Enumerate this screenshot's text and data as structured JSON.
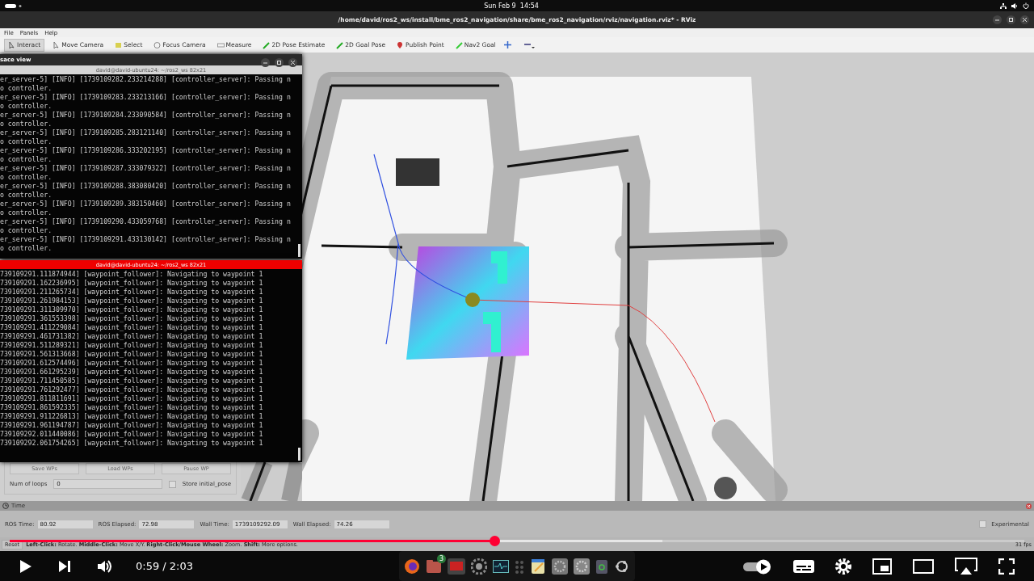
{
  "top_bar": {
    "clock": "Sun Feb 9  14:54"
  },
  "rviz": {
    "title": "/home/david/ros2_ws/install/bme_ros2_navigation/share/bme_ros2_navigation/rviz/navigation.rviz* - RViz",
    "menu": [
      "File",
      "Panels",
      "Help"
    ],
    "tools": [
      {
        "label": "Interact",
        "selected": true
      },
      {
        "label": "Move Camera",
        "selected": false
      },
      {
        "label": "Select",
        "selected": false
      },
      {
        "label": "Focus Camera",
        "selected": false
      },
      {
        "label": "Measure",
        "selected": false
      },
      {
        "label": "2D Pose Estimate",
        "selected": false
      },
      {
        "label": "2D Goal Pose",
        "selected": false
      },
      {
        "label": "Publish Point",
        "selected": false
      },
      {
        "label": "Nav2 Goal",
        "selected": false
      }
    ],
    "waypoint_panel": {
      "disabled": true,
      "buttons": [
        "Save WPs",
        "Load WPs",
        "Pause WP"
      ],
      "loops_label": "Num of loops",
      "loops_value": "0",
      "store_pose": {
        "label": "Store initial_pose",
        "checked": false
      }
    },
    "time_panel": {
      "title": "Time",
      "fields": [
        {
          "label": "ROS Time:",
          "value": "80.92"
        },
        {
          "label": "ROS Elapsed:",
          "value": "72.98"
        },
        {
          "label": "Wall Time:",
          "value": "1739109292.09"
        },
        {
          "label": "Wall Elapsed:",
          "value": "74.26"
        }
      ],
      "experimental": {
        "label": "Experimental",
        "checked": false
      }
    },
    "status_bar": {
      "reset": "Reset",
      "hint": "**Left-Click:** Rotate. **Middle-Click:** Move X/Y. **Right-Click/Mouse Wheel:** Zoom. **Shift:** More options.",
      "fps": "31 fps"
    }
  },
  "terminals": [
    {
      "window_title": "sace view",
      "title": "david@david-ubuntu24: ~/ros2_ws 82x21",
      "focused": false,
      "lines": [
        "er_server-5] [INFO] [1739109282.233214288] [controller_server]: Passing n",
        "o controller.",
        "er_server-5] [INFO] [1739109283.233213166] [controller_server]: Passing n",
        "o controller.",
        "er_server-5] [INFO] [1739109284.233090584] [controller_server]: Passing n",
        "o controller.",
        "er_server-5] [INFO] [1739109285.283121140] [controller_server]: Passing n",
        "o controller.",
        "er_server-5] [INFO] [1739109286.333202195] [controller_server]: Passing n",
        "o controller.",
        "er_server-5] [INFO] [1739109287.333079322] [controller_server]: Passing n",
        "o controller.",
        "er_server-5] [INFO] [1739109288.383080420] [controller_server]: Passing n",
        "o controller.",
        "er_server-5] [INFO] [1739109289.383150460] [controller_server]: Passing n",
        "o controller.",
        "er_server-5] [INFO] [1739109290.433059768] [controller_server]: Passing n",
        "o controller.",
        "er_server-5] [INFO] [1739109291.433130142] [controller_server]: Passing n",
        "o controller."
      ]
    },
    {
      "title": "david@david-ubuntu24: ~/ros2_ws 82x21",
      "focused": true,
      "lines": [
        "739109291.111874944] [waypoint_follower]: Navigating to waypoint 1",
        "739109291.162236995] [waypoint_follower]: Navigating to waypoint 1",
        "739109291.211265734] [waypoint_follower]: Navigating to waypoint 1",
        "739109291.261984153] [waypoint_follower]: Navigating to waypoint 1",
        "739109291.311309970] [waypoint_follower]: Navigating to waypoint 1",
        "739109291.361553398] [waypoint_follower]: Navigating to waypoint 1",
        "739109291.411229084] [waypoint_follower]: Navigating to waypoint 1",
        "739109291.461731382] [waypoint_follower]: Navigating to waypoint 1",
        "739109291.511289321] [waypoint_follower]: Navigating to waypoint 1",
        "739109291.561313668] [waypoint_follower]: Navigating to waypoint 1",
        "739109291.612574496] [waypoint_follower]: Navigating to waypoint 1",
        "739109291.661295239] [waypoint_follower]: Navigating to waypoint 1",
        "739109291.711450585] [waypoint_follower]: Navigating to waypoint 1",
        "739109291.761292477] [waypoint_follower]: Navigating to waypoint 1",
        "739109291.811811691] [waypoint_follower]: Navigating to waypoint 1",
        "739109291.861592335] [waypoint_follower]: Navigating to waypoint 1",
        "739109291.911226813] [waypoint_follower]: Navigating to waypoint 1",
        "739109291.961194787] [waypoint_follower]: Navigating to waypoint 1",
        "739109292.011440086] [waypoint_follower]: Navigating to waypoint 1",
        "739109292.061754265] [waypoint_follower]: Navigating to waypoint 1"
      ]
    }
  ],
  "dock": {
    "files_badge": "3"
  },
  "player": {
    "paused": true,
    "level": 0.478,
    "buffer": {
      "level": 0.643
    },
    "time": "0:59 / 2:03",
    "autoplay": true
  }
}
